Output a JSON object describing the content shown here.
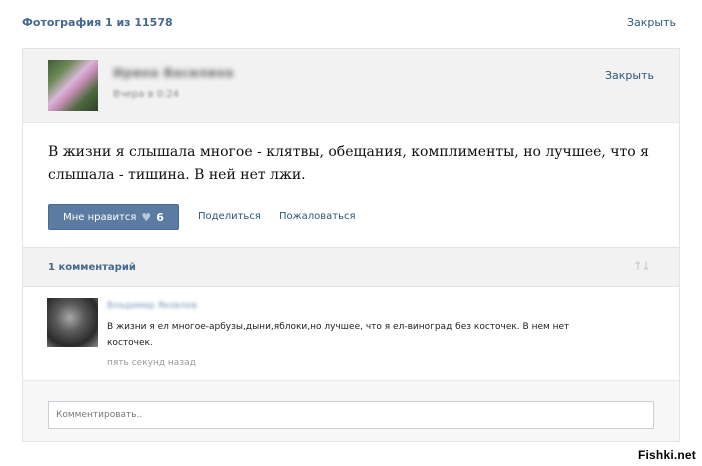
{
  "viewer": {
    "counter": "Фотография 1 из 11578",
    "close_label": "Закрыть"
  },
  "post": {
    "author": "Ирина Василина",
    "time": "Вчера в 0:24",
    "close_label": "Закрыть",
    "text": "В жизни я слышала многое - клятвы, обещания, комплименты, но лучшее, что я слышала - тишина. В ней нет лжи.",
    "like_label": "Мне нравится",
    "like_icon": "heart-icon",
    "like_count": "6",
    "share_label": "Поделиться",
    "report_label": "Пожаловаться"
  },
  "comments": {
    "count_label": "1 комментарий",
    "sort_icon": "sort-arrows-icon",
    "items": [
      {
        "author": "Владимир Яковлев",
        "text": "В жизни я ел многое-арбузы,дыни,яблоки,но лучшее, что я ел-виноград без косточек. В нем нет косточек.",
        "time": "пять секунд назад"
      }
    ]
  },
  "compose": {
    "placeholder": "Комментировать.."
  },
  "watermark": "Fishki.net",
  "colors": {
    "link": "#2b587a",
    "header_text": "#45688e",
    "like_button": "#5b7ba2"
  }
}
